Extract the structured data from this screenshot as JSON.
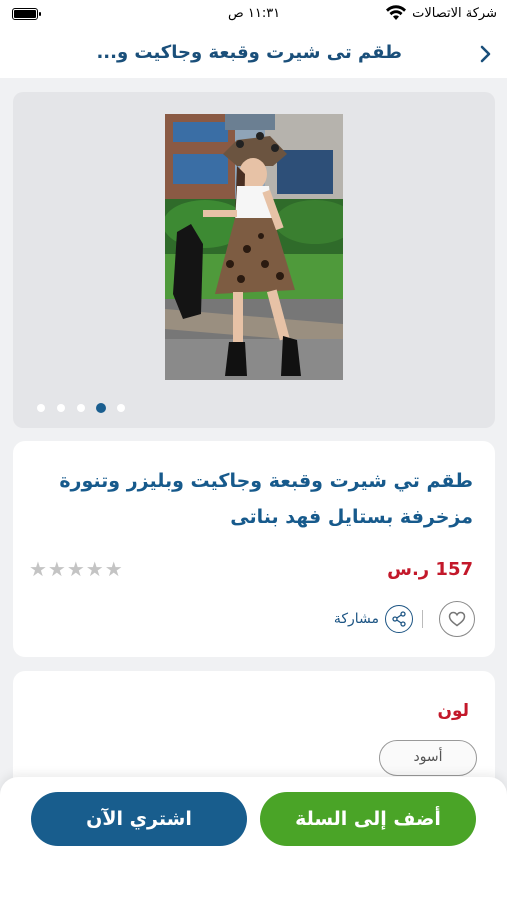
{
  "status_bar": {
    "carrier": "شركة الاتصالات",
    "time": "١١:٣١ ص"
  },
  "header": {
    "title": "طقم تى شيرت وقبعة وجاكيت و..."
  },
  "gallery": {
    "dot_count": 5,
    "active_dot": 4
  },
  "product": {
    "title": "طقم تي شيرت وقبعة وجاكيت وبليزر وتنورة مزخرفة بستايل فهد بناتى",
    "price": "157 ر.س",
    "rating_stars": "★★★★★",
    "rating": 0,
    "share_label": "مشاركة"
  },
  "options": {
    "color_label": "لون",
    "selected_color": "أسود"
  },
  "actions": {
    "add_to_cart": "أضف إلى السلة",
    "buy_now": "اشتري الآن"
  },
  "colors": {
    "brand_blue": "#185d8d",
    "price_red": "#c3182a",
    "cart_green": "#4aa427"
  }
}
